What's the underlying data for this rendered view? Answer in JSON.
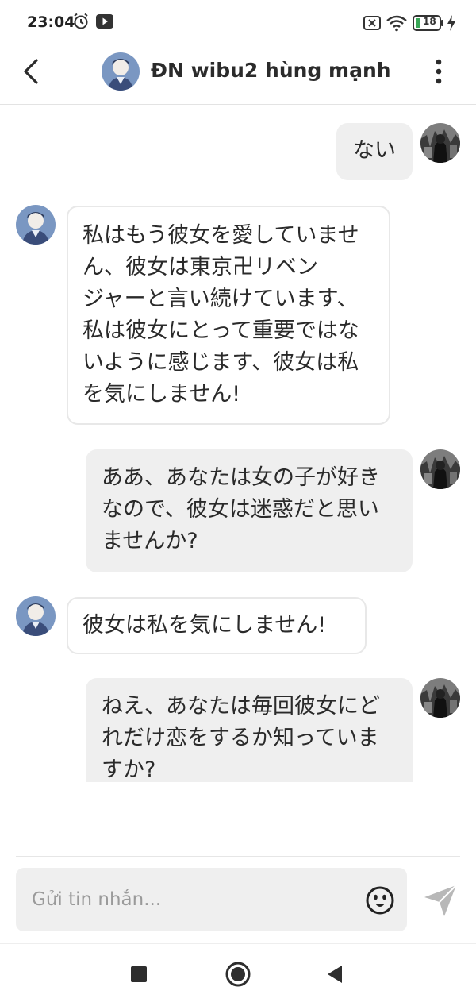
{
  "status_bar": {
    "time": "23:04",
    "battery": "18"
  },
  "header": {
    "title": "ĐN wibu2 hùng mạnh"
  },
  "messages": [
    {
      "side": "out",
      "text": "ない"
    },
    {
      "side": "in",
      "lines": [
        "私はもう彼女を愛していませ",
        "ん、彼女は東京卍リベン",
        "ジャーと言い続けています、",
        "私は彼女にとって重要ではな",
        "いように感じます、彼女は私",
        "を気にしません!"
      ]
    },
    {
      "side": "out",
      "lines": [
        "ああ、あなたは女の子が好き",
        "なので、彼女は迷惑だと思い",
        "ませんか?"
      ]
    },
    {
      "side": "in",
      "text": "彼女は私を気にしません!"
    },
    {
      "side": "out",
      "lines": [
        "ねえ、あなたは毎回彼女にど",
        "れだけ恋をするか知っていま",
        "すか?"
      ]
    }
  ],
  "composer": {
    "placeholder": "Gửi tin nhắn..."
  },
  "colors": {
    "outgoing_bubble": "#efefef",
    "incoming_border": "#e8e8e8",
    "send_icon": "#b8b8b8"
  },
  "icons": [
    "alarm-icon",
    "youtube-icon",
    "sim-off-icon",
    "wifi-icon",
    "battery-icon",
    "charging-icon",
    "back-arrow-icon",
    "more-vertical-icon",
    "emoji-icon",
    "send-icon",
    "nav-recents-icon",
    "nav-home-icon",
    "nav-back-icon"
  ]
}
